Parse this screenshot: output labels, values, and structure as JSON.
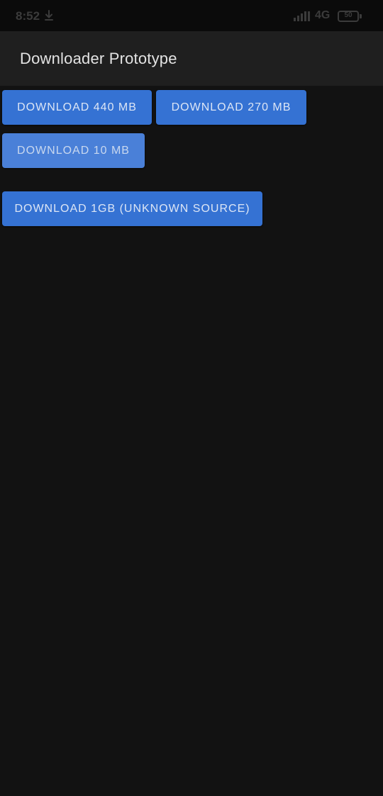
{
  "status_bar": {
    "time": "8:52",
    "network": "4G",
    "battery_level": "50"
  },
  "app_bar": {
    "title": "Downloader Prototype"
  },
  "buttons": {
    "download_440": "DOWNLOAD 440 MB",
    "download_270": "DOWNLOAD 270 MB",
    "download_10": "DOWNLOAD 10 MB",
    "download_1gb": "DOWNLOAD 1GB (UNKNOWN SOURCE)"
  },
  "colors": {
    "background": "#121212",
    "app_bar": "#1f1f1f",
    "button": "#3572d3",
    "button_pressed": "#4a80d8"
  }
}
